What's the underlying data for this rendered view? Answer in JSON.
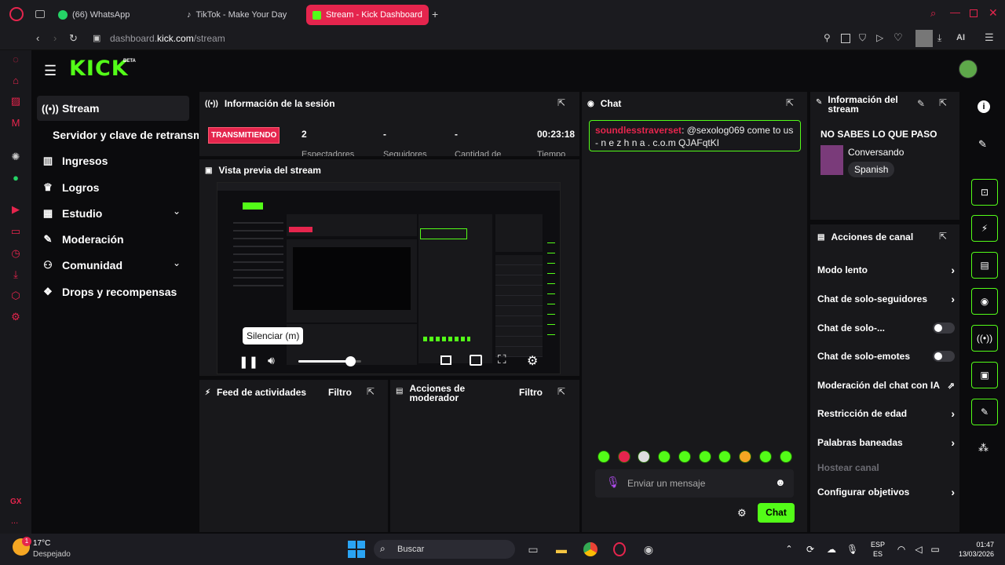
{
  "browser": {
    "tabs": [
      {
        "label": "(66) WhatsApp"
      },
      {
        "label": "TikTok - Make Your Day"
      },
      {
        "label": "Stream - Kick Dashboard"
      }
    ],
    "address": {
      "domain_pre": "dashboard.",
      "domain_main": "kick.com",
      "path": "/stream"
    },
    "ai_label": "AI"
  },
  "opera_sidebar": {
    "gx_label": "GX",
    "more_label": "..."
  },
  "kick": {
    "logo": "KICK",
    "logo_badge": "BETA",
    "nav": [
      {
        "label": "Stream",
        "icon": "broadcast-icon"
      },
      {
        "label": "Servidor y clave de retransm"
      },
      {
        "label": "Ingresos",
        "icon": "chart-icon"
      },
      {
        "label": "Logros",
        "icon": "trophy-icon"
      },
      {
        "label": "Estudio",
        "icon": "studio-icon"
      },
      {
        "label": "Moderación",
        "icon": "wrench-icon"
      },
      {
        "label": "Comunidad",
        "icon": "community-icon"
      },
      {
        "label": "Drops y recompensas",
        "icon": "gift-icon"
      }
    ],
    "session": {
      "title": "Información de la sesión",
      "status": "TRANSMITIENDO",
      "viewers": "2",
      "followers": "-",
      "subs": "-",
      "time": "00:23:18",
      "labels": [
        "Espectadores",
        "Seguidores",
        "Cantidad de",
        "Tiempo"
      ]
    },
    "preview": {
      "title": "Vista previa del stream",
      "tooltip": "Silenciar (m)",
      "volume_level": 0.82
    },
    "feed": {
      "title": "Feed de actividades",
      "filter": "Filtro"
    },
    "mod_actions": {
      "title_l1": "Acciones de",
      "title_l2": "moderador",
      "filter": "Filtro"
    },
    "chat": {
      "title": "Chat",
      "message_user": "soundlesstraverset",
      "message_text": ": @sexolog069 come to us - n e z h n a . c.o.m QJAFqtKI",
      "input_placeholder": "Enviar un mensaje",
      "send_label": "Chat"
    },
    "stream_info": {
      "title_l1": "Información del",
      "title_l2": "stream",
      "stream_title": "NO SABES LO QUE PASO",
      "category": "Conversando",
      "language": "Spanish"
    },
    "channel_actions": {
      "title": "Acciones de canal",
      "items": [
        {
          "label": "Modo lento"
        },
        {
          "label": "Chat de solo-seguidores"
        },
        {
          "label": "Chat de solo-..."
        },
        {
          "label": "Chat de solo-emotes"
        },
        {
          "label": "Moderación del chat con IA"
        },
        {
          "label": "Restricción de edad"
        },
        {
          "label": "Palabras baneadas"
        },
        {
          "label": "Hostear canal"
        },
        {
          "label": "Configurar objetivos"
        }
      ]
    }
  },
  "taskbar": {
    "weather_temp": "17°C",
    "weather_desc": "Despejado",
    "weather_badge": "1",
    "search_label": "Buscar",
    "lang_l1": "ESP",
    "lang_l2": "ES",
    "time": "01:47",
    "date": "13/03/2026"
  },
  "colors": {
    "accent": "#53fc18",
    "live": "#e5254d",
    "opera": "#e5254d",
    "panel": "#18181b"
  }
}
